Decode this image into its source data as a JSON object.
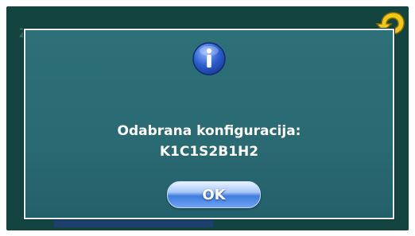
{
  "screen": {
    "background_title": "Z...",
    "back_icon": "back-arrow-icon"
  },
  "dialog": {
    "icon": "info-icon",
    "message_line1": "Odabrana konfiguracija:",
    "message_line2": "K1C1S2B1H2",
    "ok_label": "OK"
  },
  "colors": {
    "screen_bg": "#14443f",
    "dialog_bg": "#2b6c74",
    "info_blue": "#2d5fd0",
    "ok_blue": "#3f7ddf",
    "back_arrow_yellow": "#f2c818"
  }
}
